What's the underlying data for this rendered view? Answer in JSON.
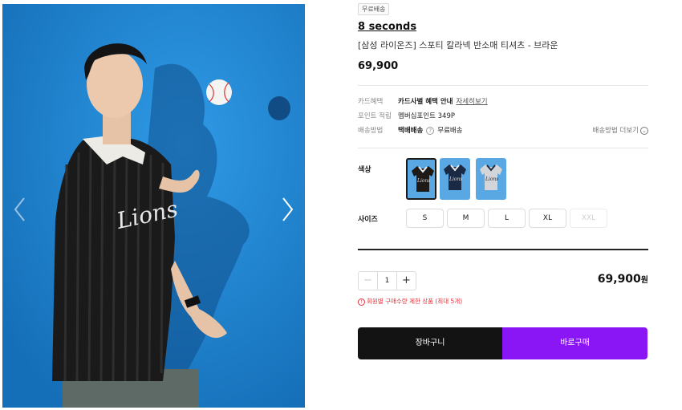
{
  "badge": "무료배송",
  "brand": "8 seconds",
  "product_name": "[삼성 라이온즈] 스포티 칼라넥 반소매 티셔츠 - 브라운",
  "price": "69,900",
  "details": {
    "card": {
      "label": "카드혜택",
      "value": "카드사별 혜택 안내",
      "link": "자세히보기"
    },
    "point": {
      "label": "포인트 적립",
      "value": "멤버십포인트 349P"
    },
    "shipping": {
      "label": "배송방법",
      "method": "택배배송",
      "help_icon": "?",
      "value": "무료배송",
      "more": "배송방법 더보기",
      "more_icon": "⌄"
    }
  },
  "options": {
    "color_label": "색상",
    "colors": [
      {
        "name": "brown",
        "color": "#1e1a18",
        "selected": true
      },
      {
        "name": "navy",
        "color": "#1b2a44",
        "selected": false
      },
      {
        "name": "grey",
        "color": "#cfd1d4",
        "selected": false
      }
    ],
    "size_label": "사이즈",
    "sizes": [
      "S",
      "M",
      "L",
      "XL",
      "XXL"
    ]
  },
  "quantity": {
    "minus": "−",
    "value": "1",
    "plus": "+"
  },
  "total": {
    "amount": "69,900",
    "unit": "원"
  },
  "limit_icon": "!",
  "limit_notice": "회원별 구매수량 제한 상품 (최대 5개)",
  "buttons": {
    "cart": "장바구니",
    "buy": "바로구매"
  },
  "colors": {
    "accent": "#8a16f5",
    "dark": "#131313",
    "warning": "#e0323c",
    "photo_bg": "#1e88d6"
  }
}
